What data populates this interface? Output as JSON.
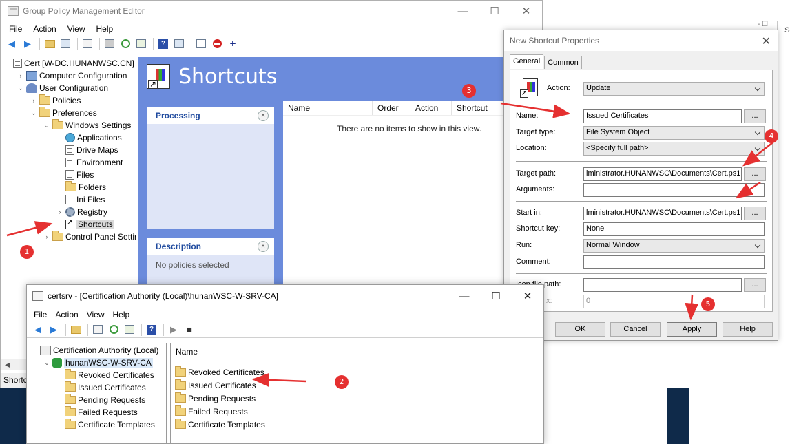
{
  "gpm": {
    "title": "Group Policy Management Editor",
    "menu": [
      "File",
      "Action",
      "View",
      "Help"
    ],
    "tree": [
      {
        "label": "Cert [W-DC.HUNANWSC.CN] P",
        "icon": "doc",
        "indent": 0,
        "expander": ""
      },
      {
        "label": "Computer Configuration",
        "icon": "comp",
        "indent": 1,
        "expander": ">"
      },
      {
        "label": "User Configuration",
        "icon": "users",
        "indent": 1,
        "expander": "v"
      },
      {
        "label": "Policies",
        "icon": "folder",
        "indent": 2,
        "expander": ">"
      },
      {
        "label": "Preferences",
        "icon": "folder",
        "indent": 2,
        "expander": "v"
      },
      {
        "label": "Windows Settings",
        "icon": "folder",
        "indent": 3,
        "expander": "v"
      },
      {
        "label": "Applications",
        "icon": "globe",
        "indent": 4,
        "expander": ""
      },
      {
        "label": "Drive Maps",
        "icon": "doc",
        "indent": 4,
        "expander": ""
      },
      {
        "label": "Environment",
        "icon": "doc",
        "indent": 4,
        "expander": ""
      },
      {
        "label": "Files",
        "icon": "doc",
        "indent": 4,
        "expander": ""
      },
      {
        "label": "Folders",
        "icon": "folder",
        "indent": 4,
        "expander": ""
      },
      {
        "label": "Ini Files",
        "icon": "doc",
        "indent": 4,
        "expander": ""
      },
      {
        "label": "Registry",
        "icon": "gear",
        "indent": 4,
        "expander": ">"
      },
      {
        "label": "Shortcuts",
        "icon": "shortcut",
        "indent": 4,
        "expander": "",
        "selected": true
      },
      {
        "label": "Control Panel Setting",
        "icon": "folder",
        "indent": 3,
        "expander": ">"
      }
    ],
    "status": "Shortcu",
    "heading": "Shortcuts",
    "processing_title": "Processing",
    "description_title": "Description",
    "description_text": "No policies selected",
    "columns": [
      "Name",
      "Order",
      "Action",
      "Shortcut"
    ],
    "empty_message": "There are no items to show in this view."
  },
  "dialog": {
    "title": "New Shortcut Properties",
    "tabs": [
      "General",
      "Common"
    ],
    "action_label": "Action:",
    "action_value": "Update",
    "fields": {
      "name_label": "Name:",
      "name_value": "Issued Certificates",
      "target_type_label": "Target type:",
      "target_type_value": "File System Object",
      "location_label": "Location:",
      "location_value": "<Specify full path>",
      "target_path_label": "Target path:",
      "target_path_value": "lministrator.HUNANWSC\\Documents\\Cert.ps1",
      "arguments_label": "Arguments:",
      "arguments_value": "",
      "start_in_label": "Start in:",
      "start_in_value": "lministrator.HUNANWSC\\Documents\\Cert.ps1",
      "shortcut_key_label": "Shortcut key:",
      "shortcut_key_value": "None",
      "run_label": "Run:",
      "run_value": "Normal Window",
      "comment_label": "Comment:",
      "comment_value": "",
      "icon_path_label": "Icon file path:",
      "icon_path_value": "",
      "icon_index_label": "x:",
      "icon_index_value": "0"
    },
    "browse": "...",
    "buttons": {
      "ok": "OK",
      "cancel": "Cancel",
      "apply": "Apply",
      "help": "Help"
    }
  },
  "certsrv": {
    "title": "certsrv - [Certification Authority (Local)\\hunanWSC-W-SRV-CA]",
    "menu": [
      "File",
      "Action",
      "View",
      "Help"
    ],
    "tree": [
      {
        "label": "Certification Authority (Local)",
        "icon": "ca",
        "indent": 0,
        "expander": ""
      },
      {
        "label": "hunanWSC-W-SRV-CA",
        "icon": "cacert",
        "indent": 1,
        "expander": "v",
        "selected": true
      },
      {
        "label": "Revoked Certificates",
        "icon": "folder",
        "indent": 2,
        "expander": ""
      },
      {
        "label": "Issued Certificates",
        "icon": "folder",
        "indent": 2,
        "expander": ""
      },
      {
        "label": "Pending Requests",
        "icon": "folder",
        "indent": 2,
        "expander": ""
      },
      {
        "label": "Failed Requests",
        "icon": "folder",
        "indent": 2,
        "expander": ""
      },
      {
        "label": "Certificate Templates",
        "icon": "folder",
        "indent": 2,
        "expander": ""
      }
    ],
    "column": "Name",
    "items": [
      "Revoked Certificates",
      "Issued Certificates",
      "Pending Requests",
      "Failed Requests",
      "Certificate Templates"
    ]
  },
  "background": {
    "fragment": "Se"
  },
  "annotations": [
    "1",
    "2",
    "3",
    "4",
    "5"
  ],
  "colors": {
    "annotation": "#e53030",
    "gpm_pane": "#6b8bdc",
    "heading_link": "#1f4a9e"
  }
}
